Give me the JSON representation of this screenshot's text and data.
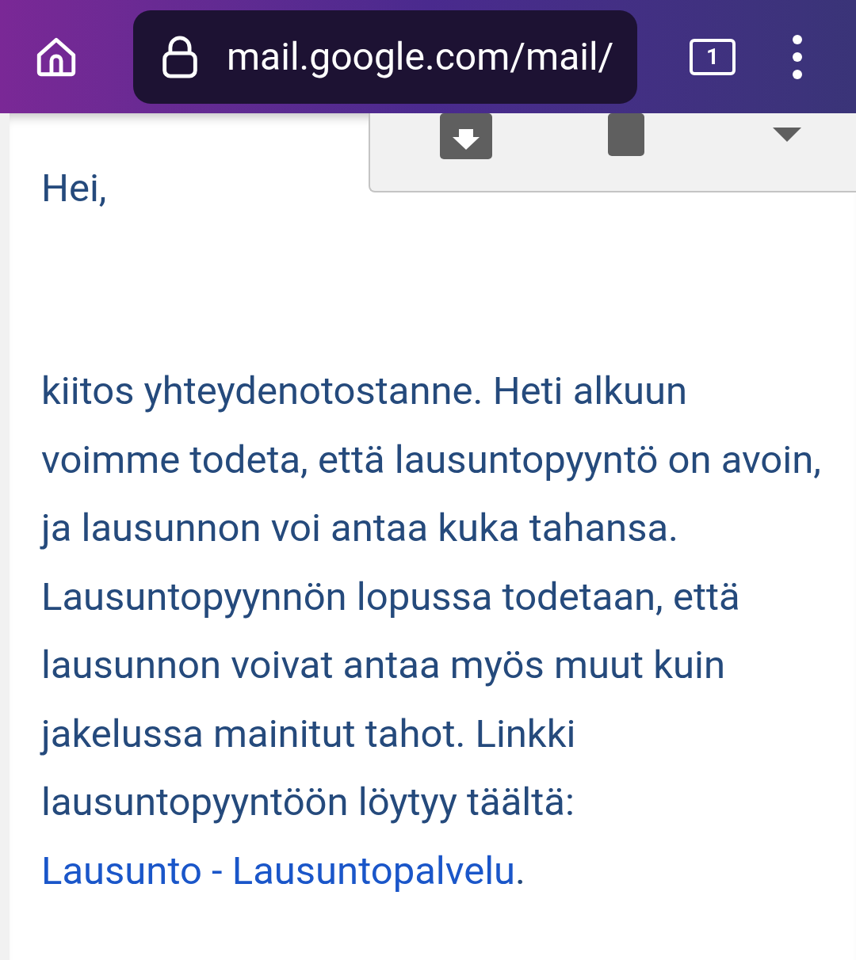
{
  "browser": {
    "url": "mail.google.com/mail/",
    "tab_count": "1"
  },
  "message": {
    "greeting": "Hei,",
    "paragraph": "kiitos yhteydenotostanne. Heti alkuun voimme todeta, että lausuntopyyntö on avoin, ja lausunnon voi antaa kuka tahansa. Lausuntopyynnön lopussa todetaan, että lausunnon voivat antaa myös muut kuin jakelussa mainitut tahot. Linkki lausuntopyyntöön löytyy täältä: ",
    "link": "Lausunto - Lausuntopalvelu",
    "after_link": "."
  }
}
